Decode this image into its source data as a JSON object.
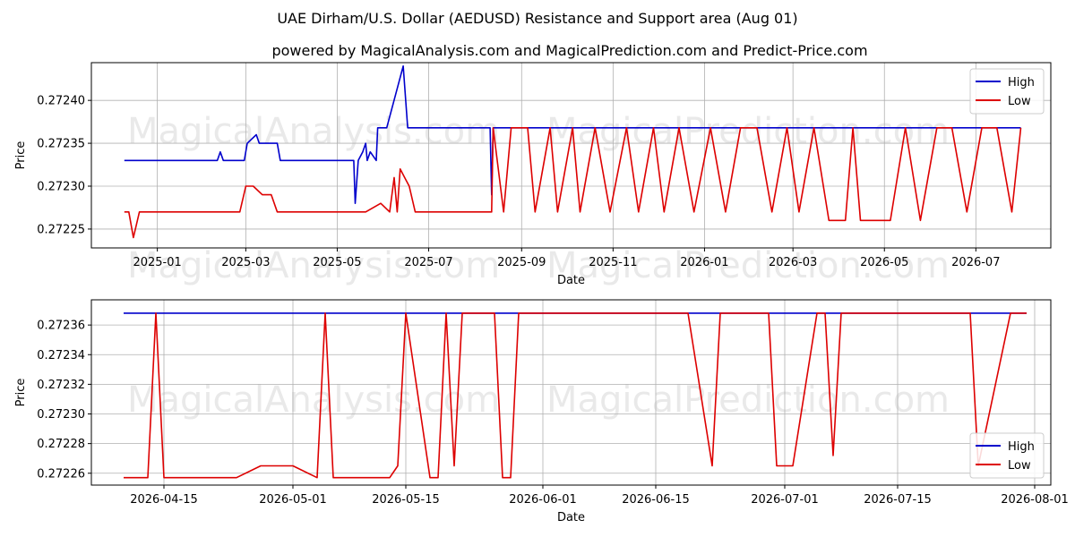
{
  "title": "UAE Dirham/U.S. Dollar (AEDUSD) Resistance and Support area (Aug 01)",
  "subtitle": "powered by MagicalAnalysis.com and MagicalPrediction.com and Predict-Price.com",
  "watermarks": [
    "MagicalAnalysis.com",
    "MagicalPrediction.com"
  ],
  "colors": {
    "high": "#0000cc",
    "low": "#dd0000",
    "grid": "#b0b0b0"
  },
  "chart_data": [
    {
      "type": "line",
      "xlabel": "Date",
      "ylabel": "Price",
      "grid": true,
      "legend_position": "top-right",
      "xlim": [
        "2024-11-18",
        "2026-08-20"
      ],
      "ylim": [
        0.272228,
        0.272444
      ],
      "x_ticks": [
        "2025-01",
        "2025-03",
        "2025-05",
        "2025-07",
        "2025-09",
        "2025-11",
        "2026-01",
        "2026-03",
        "2026-05",
        "2026-07"
      ],
      "x_tick_dates": [
        "2025-01-01",
        "2025-03-01",
        "2025-05-01",
        "2025-07-01",
        "2025-09-01",
        "2025-11-01",
        "2026-01-01",
        "2026-03-01",
        "2026-05-01",
        "2026-07-01"
      ],
      "y_ticks": [
        "0.27225",
        "0.27230",
        "0.27235",
        "0.27240"
      ],
      "y_tick_values": [
        0.27225,
        0.2723,
        0.27235,
        0.2724
      ],
      "series": [
        {
          "name": "High",
          "x": [
            "2024-12-10",
            "2025-02-10",
            "2025-02-12",
            "2025-02-14",
            "2025-02-28",
            "2025-03-02",
            "2025-03-08",
            "2025-03-10",
            "2025-03-22",
            "2025-03-24",
            "2025-05-12",
            "2025-05-13",
            "2025-05-15",
            "2025-05-18",
            "2025-05-20",
            "2025-05-21",
            "2025-05-23",
            "2025-05-27",
            "2025-05-28",
            "2025-06-03",
            "2025-06-14",
            "2025-06-17",
            "2025-08-11",
            "2025-08-12",
            "2025-08-13",
            "2026-07-31"
          ],
          "y": [
            0.27233,
            0.27233,
            0.27234,
            0.27233,
            0.27233,
            0.27235,
            0.27236,
            0.27235,
            0.27235,
            0.27233,
            0.27233,
            0.27228,
            0.27233,
            0.27234,
            0.27235,
            0.27233,
            0.27234,
            0.27233,
            0.272368,
            0.272368,
            0.27244,
            0.272368,
            0.272368,
            0.27229,
            0.272368,
            0.272368
          ]
        },
        {
          "name": "Low",
          "x": [
            "2024-12-10",
            "2024-12-13",
            "2024-12-16",
            "2024-12-20",
            "2024-12-25",
            "2025-01-05",
            "2025-01-15",
            "2025-01-25",
            "2025-02-05",
            "2025-02-15",
            "2025-02-25",
            "2025-03-01",
            "2025-03-06",
            "2025-03-12",
            "2025-03-18",
            "2025-03-22",
            "2025-03-28",
            "2025-04-05",
            "2025-04-20",
            "2025-05-05",
            "2025-05-20",
            "2025-05-30",
            "2025-06-05",
            "2025-06-08",
            "2025-06-10",
            "2025-06-12",
            "2025-06-15",
            "2025-06-18",
            "2025-06-22",
            "2025-06-28",
            "2025-07-05",
            "2025-07-20",
            "2025-08-05",
            "2025-08-12",
            "2025-08-13",
            "2025-08-20",
            "2025-08-25",
            "2025-09-05",
            "2025-09-10",
            "2025-09-20",
            "2025-09-25",
            "2025-10-05",
            "2025-10-10",
            "2025-10-20",
            "2025-10-30",
            "2025-11-10",
            "2025-11-18",
            "2025-11-28",
            "2025-12-05",
            "2025-12-15",
            "2025-12-25",
            "2026-01-05",
            "2026-01-15",
            "2026-01-25",
            "2026-02-05",
            "2026-02-15",
            "2026-02-25",
            "2026-03-05",
            "2026-03-15",
            "2026-03-25",
            "2026-04-05",
            "2026-04-10",
            "2026-04-15",
            "2026-04-25",
            "2026-05-05",
            "2026-05-15",
            "2026-05-25",
            "2026-06-05",
            "2026-06-15",
            "2026-06-25",
            "2026-07-05",
            "2026-07-15",
            "2026-07-25",
            "2026-07-31"
          ],
          "y": [
            0.27227,
            0.27227,
            0.27224,
            0.27227,
            0.27227,
            0.27227,
            0.27227,
            0.27227,
            0.27227,
            0.27227,
            0.27227,
            0.2723,
            0.2723,
            0.27229,
            0.27229,
            0.27227,
            0.27227,
            0.27227,
            0.27227,
            0.27227,
            0.27227,
            0.27228,
            0.27227,
            0.27231,
            0.27227,
            0.27232,
            0.27231,
            0.2723,
            0.27227,
            0.27227,
            0.27227,
            0.27227,
            0.27227,
            0.27227,
            0.272368,
            0.27227,
            0.272368,
            0.272368,
            0.27227,
            0.272368,
            0.27227,
            0.272368,
            0.27227,
            0.272368,
            0.27227,
            0.272368,
            0.27227,
            0.272368,
            0.27227,
            0.272368,
            0.27227,
            0.272368,
            0.27227,
            0.272368,
            0.272368,
            0.27227,
            0.272368,
            0.27227,
            0.272368,
            0.27226,
            0.27226,
            0.272368,
            0.27226,
            0.27226,
            0.27226,
            0.272368,
            0.27226,
            0.272368,
            0.272368,
            0.27227,
            0.272368,
            0.272368,
            0.27227,
            0.272368
          ]
        }
      ]
    },
    {
      "type": "line",
      "xlabel": "Date",
      "ylabel": "Price",
      "grid": true,
      "legend_position": "bottom-right",
      "xlim": [
        "2026-04-06",
        "2026-08-03"
      ],
      "ylim": [
        0.272252,
        0.272377
      ],
      "x_ticks": [
        "2026-04-15",
        "2026-05-01",
        "2026-05-15",
        "2026-06-01",
        "2026-06-15",
        "2026-07-01",
        "2026-07-15",
        "2026-08-01"
      ],
      "x_tick_dates": [
        "2026-04-15",
        "2026-05-01",
        "2026-05-15",
        "2026-06-01",
        "2026-06-15",
        "2026-07-01",
        "2026-07-15",
        "2026-08-01"
      ],
      "y_ticks": [
        "0.27226",
        "0.27228",
        "0.27230",
        "0.27232",
        "0.27234",
        "0.27236"
      ],
      "y_tick_values": [
        0.27226,
        0.27228,
        0.2723,
        0.27232,
        0.27234,
        0.27236
      ],
      "series": [
        {
          "name": "High",
          "x": [
            "2026-04-10",
            "2026-07-31"
          ],
          "y": [
            0.272368,
            0.272368
          ]
        },
        {
          "name": "Low",
          "x": [
            "2026-04-10",
            "2026-04-13",
            "2026-04-14",
            "2026-04-15",
            "2026-04-24",
            "2026-04-27",
            "2026-05-01",
            "2026-05-04",
            "2026-05-05",
            "2026-05-06",
            "2026-05-13",
            "2026-05-14",
            "2026-05-15",
            "2026-05-18",
            "2026-05-19",
            "2026-05-20",
            "2026-05-21",
            "2026-05-22",
            "2026-05-26",
            "2026-05-27",
            "2026-05-28",
            "2026-05-29",
            "2026-06-19",
            "2026-06-22",
            "2026-06-23",
            "2026-06-29",
            "2026-06-30",
            "2026-07-02",
            "2026-07-05",
            "2026-07-06",
            "2026-07-07",
            "2026-07-08",
            "2026-07-24",
            "2026-07-25",
            "2026-07-29",
            "2026-07-31"
          ],
          "y": [
            0.272257,
            0.272257,
            0.272368,
            0.272257,
            0.272257,
            0.272265,
            0.272265,
            0.272257,
            0.272368,
            0.272257,
            0.272257,
            0.272265,
            0.272368,
            0.272257,
            0.272257,
            0.272368,
            0.272265,
            0.272368,
            0.272368,
            0.272257,
            0.272257,
            0.272368,
            0.272368,
            0.272265,
            0.272368,
            0.272368,
            0.272265,
            0.272265,
            0.272368,
            0.272368,
            0.272272,
            0.272368,
            0.272368,
            0.272265,
            0.272368,
            0.272368
          ]
        }
      ]
    }
  ]
}
